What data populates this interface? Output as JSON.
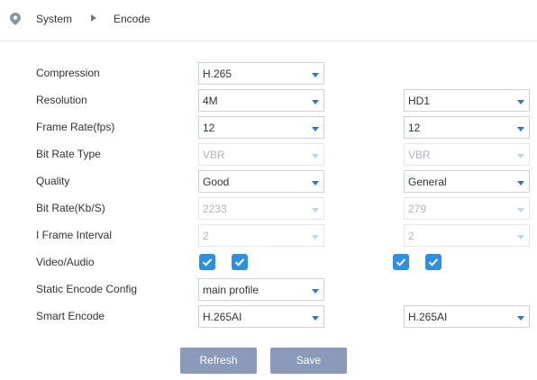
{
  "breadcrumb": {
    "root": "System",
    "current": "Encode"
  },
  "rows": [
    {
      "label": "Compression",
      "main": "H.265",
      "sub": null
    },
    {
      "label": "Resolution",
      "main": "4M",
      "sub": "HD1"
    },
    {
      "label": "Frame Rate(fps)",
      "main": "12",
      "sub": "12"
    },
    {
      "label": "Bit Rate Type",
      "main": "VBR",
      "sub": "VBR"
    },
    {
      "label": "Quality",
      "main": "Good",
      "sub": "General"
    },
    {
      "label": "Bit Rate(Kb/S)",
      "main": "2233",
      "sub": "279"
    },
    {
      "label": "I Frame Interval",
      "main": "2",
      "sub": "2"
    },
    {
      "label": "Video/Audio",
      "main_video": true,
      "main_audio": true,
      "sub_video": true,
      "sub_audio": true
    },
    {
      "label": "Static Encode Config",
      "main": "main profile",
      "sub": null
    },
    {
      "label": "Smart Encode",
      "main": "H.265AI",
      "sub": "H.265AI"
    }
  ],
  "buttons": {
    "refresh": "Refresh",
    "save": "Save"
  },
  "colors": {
    "accent": "#2e90df",
    "button": "#8b9ab8",
    "arrow": "#1d7ecf"
  },
  "icons": {
    "breadcrumb": "location-pin-icon",
    "separator": "caret-right-icon",
    "checkbox": "checkmark-icon"
  }
}
